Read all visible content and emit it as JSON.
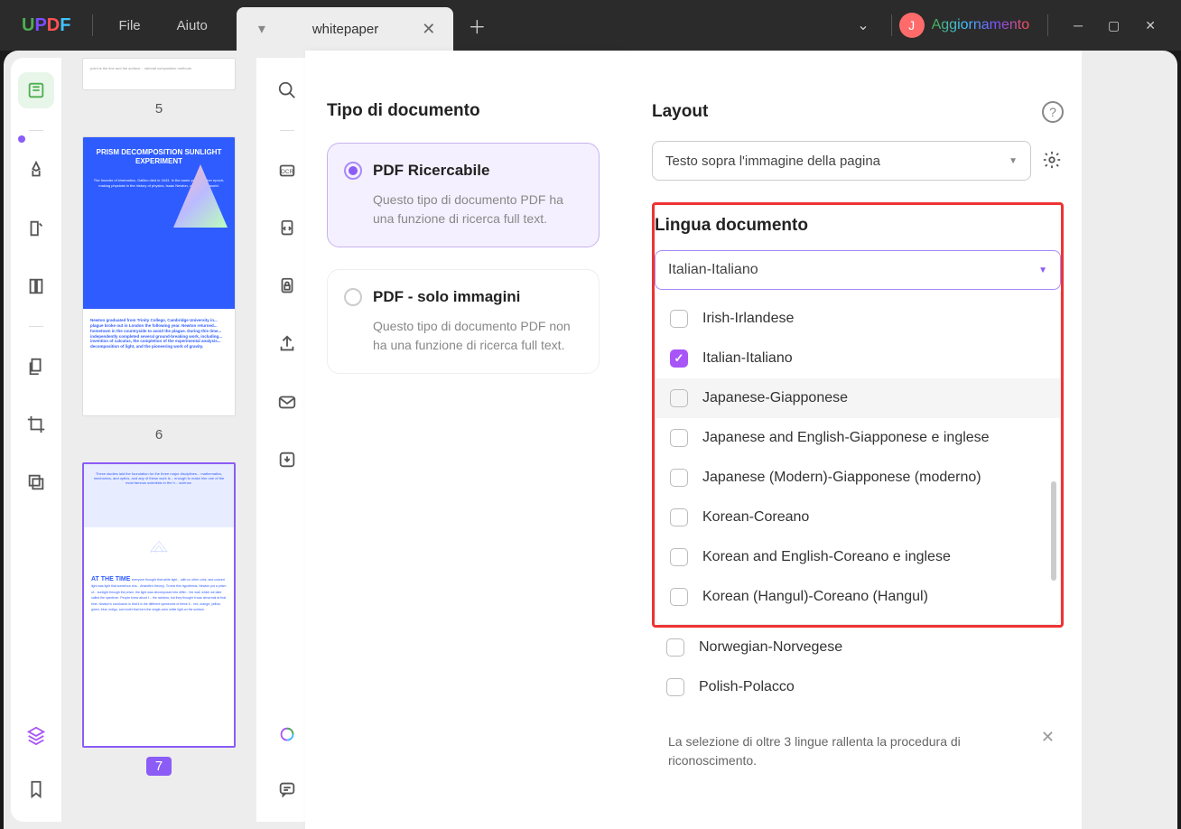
{
  "app": {
    "logo": [
      "U",
      "P",
      "D",
      "F"
    ]
  },
  "menu": {
    "file": "File",
    "help": "Aiuto"
  },
  "tab": {
    "title": "whitepaper"
  },
  "user": {
    "initial": "J",
    "upgrade": "Aggiornamento"
  },
  "thumbs": {
    "p5": "5",
    "p6": "6",
    "p7": "7",
    "p6_title": "PRISM DECOMPOSITION SUNLIGHT EXPERIMENT",
    "p7_heading": "AT THE TIME"
  },
  "doctype": {
    "title": "Tipo di documento",
    "opt1_label": "PDF Ricercabile",
    "opt1_desc": "Questo tipo di documento PDF ha una funzione di ricerca full text.",
    "opt2_label": "PDF - solo immagini",
    "opt2_desc": "Questo tipo di documento PDF non ha una funzione di ricerca full text."
  },
  "layout": {
    "label": "Layout",
    "value": "Testo sopra l'immagine della pagina"
  },
  "lang": {
    "label": "Lingua documento",
    "selected": "Italian-Italiano",
    "items": [
      {
        "name": "Irish-Irlandese",
        "checked": false
      },
      {
        "name": "Italian-Italiano",
        "checked": true
      },
      {
        "name": "Japanese-Giapponese",
        "checked": false,
        "hover": true
      },
      {
        "name": "Japanese and English-Giapponese e inglese",
        "checked": false
      },
      {
        "name": "Japanese (Modern)-Giapponese (moderno)",
        "checked": false
      },
      {
        "name": "Korean-Coreano",
        "checked": false
      },
      {
        "name": "Korean and English-Coreano e inglese",
        "checked": false
      },
      {
        "name": "Korean (Hangul)-Coreano (Hangul)",
        "checked": false
      }
    ],
    "extra": [
      {
        "name": "Norwegian-Norvegese",
        "checked": false
      },
      {
        "name": "Polish-Polacco",
        "checked": false
      }
    ],
    "hint": "La selezione di oltre 3 lingue rallenta la procedura di riconoscimento."
  }
}
